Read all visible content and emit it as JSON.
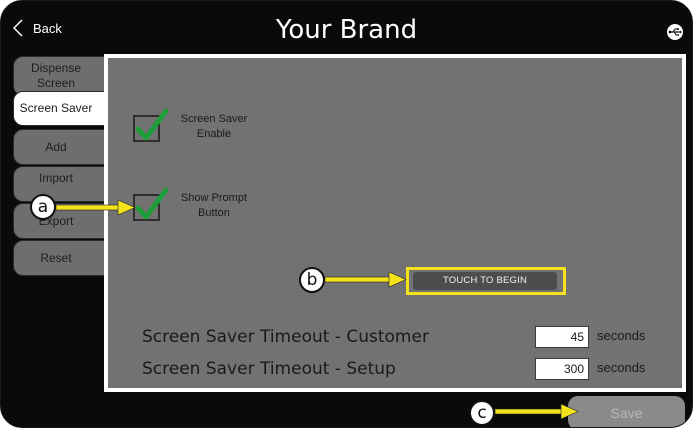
{
  "header": {
    "back_label": "Back",
    "title": "Your Brand"
  },
  "sidebar": {
    "tabs": [
      {
        "label": "Dispense Screen"
      },
      {
        "label": "Screen Saver"
      },
      {
        "label": "Add"
      },
      {
        "label": "Import"
      },
      {
        "label": "Export"
      },
      {
        "label": "Reset"
      }
    ]
  },
  "panel": {
    "screen_saver_enable": {
      "label": "Screen Saver Enable",
      "checked": true
    },
    "show_prompt_button": {
      "label": "Show Prompt Button",
      "checked": true
    },
    "prompt_button_text": "TOUCH TO BEGIN",
    "timeout_customer": {
      "label": "Screen Saver Timeout - Customer",
      "value": "45",
      "unit": "seconds"
    },
    "timeout_setup": {
      "label": "Screen Saver Timeout - Setup",
      "value": "300",
      "unit": "seconds"
    }
  },
  "footer": {
    "save_label": "Save"
  },
  "annotations": {
    "a": "a",
    "b": "b",
    "c": "c"
  },
  "colors": {
    "check_green": "#1e9e3a",
    "annotation_yellow": "#f4e31a",
    "panel_gray": "#727272"
  },
  "icons": [
    "chevron-left-icon",
    "usb-icon",
    "checkmark-icon"
  ]
}
